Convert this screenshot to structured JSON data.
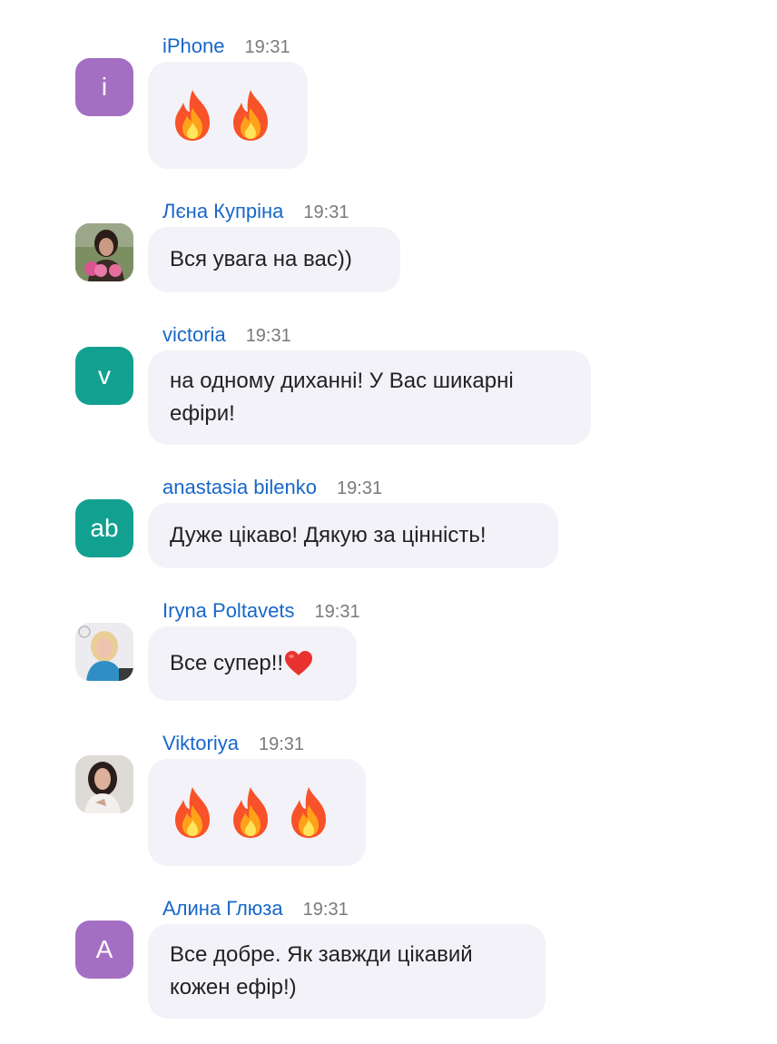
{
  "messages": [
    {
      "name": "iPhone",
      "time": "19:31",
      "avatar_letter": "i",
      "avatar_color": "#a46fc2",
      "text": "",
      "emoji": [
        "fire",
        "fire"
      ]
    },
    {
      "name": "Лєна Купріна",
      "time": "19:31",
      "avatar_letter": "",
      "avatar_color": "",
      "text": "Вся увага на вас))",
      "emoji": []
    },
    {
      "name": "victoria",
      "time": "19:31",
      "avatar_letter": "v",
      "avatar_color": "#12a090",
      "text_line1": "на одному диханні! У Вас шикарні",
      "text_line2": "ефіри!",
      "emoji": []
    },
    {
      "name": "anastasia bilenko",
      "time": "19:31",
      "avatar_letter": "ab",
      "avatar_color": "#12a090",
      "text": "Дуже цікаво! Дякую за цінність!",
      "emoji": []
    },
    {
      "name": "Iryna Poltavets",
      "time": "19:31",
      "avatar_letter": "",
      "avatar_color": "",
      "text": "Все супер!!",
      "emoji": [
        "heart"
      ]
    },
    {
      "name": "Viktoriya",
      "time": "19:31",
      "avatar_letter": "",
      "avatar_color": "",
      "text": "",
      "emoji": [
        "fire",
        "fire",
        "fire"
      ]
    },
    {
      "name": "Алина Глюза",
      "time": "19:31",
      "avatar_letter": "A",
      "avatar_color": "#a46fc2",
      "text_line1": "Все добре. Як завжди цікавий",
      "text_line2": "кожен ефір!)",
      "emoji": []
    }
  ]
}
